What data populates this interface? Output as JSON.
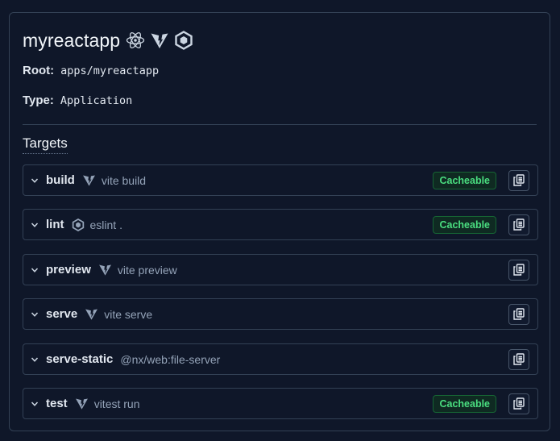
{
  "project": {
    "title": "myreactapp",
    "title_icons": [
      "react-icon",
      "vite-icon",
      "eslint-icon"
    ],
    "root_label": "Root:",
    "root_value": "apps/myreactapp",
    "type_label": "Type:",
    "type_value": "Application"
  },
  "targets_section": {
    "title": "Targets"
  },
  "targets": [
    {
      "name": "build",
      "icon": "vite-icon",
      "command": "vite build",
      "cacheable": true
    },
    {
      "name": "lint",
      "icon": "eslint-icon",
      "command": "eslint .",
      "cacheable": true
    },
    {
      "name": "preview",
      "icon": "vite-icon",
      "command": "vite preview",
      "cacheable": false
    },
    {
      "name": "serve",
      "icon": "vite-icon",
      "command": "vite serve",
      "cacheable": false
    },
    {
      "name": "serve-static",
      "icon": "",
      "command": "@nx/web:file-server",
      "cacheable": false
    },
    {
      "name": "test",
      "icon": "vite-icon",
      "command": "vitest run",
      "cacheable": true
    }
  ],
  "badge_label": "Cacheable",
  "colors": {
    "background": "#0f1729",
    "border": "#334155",
    "badge_text": "#4ade80",
    "badge_border": "#166534",
    "muted_text": "#94a3b8"
  }
}
